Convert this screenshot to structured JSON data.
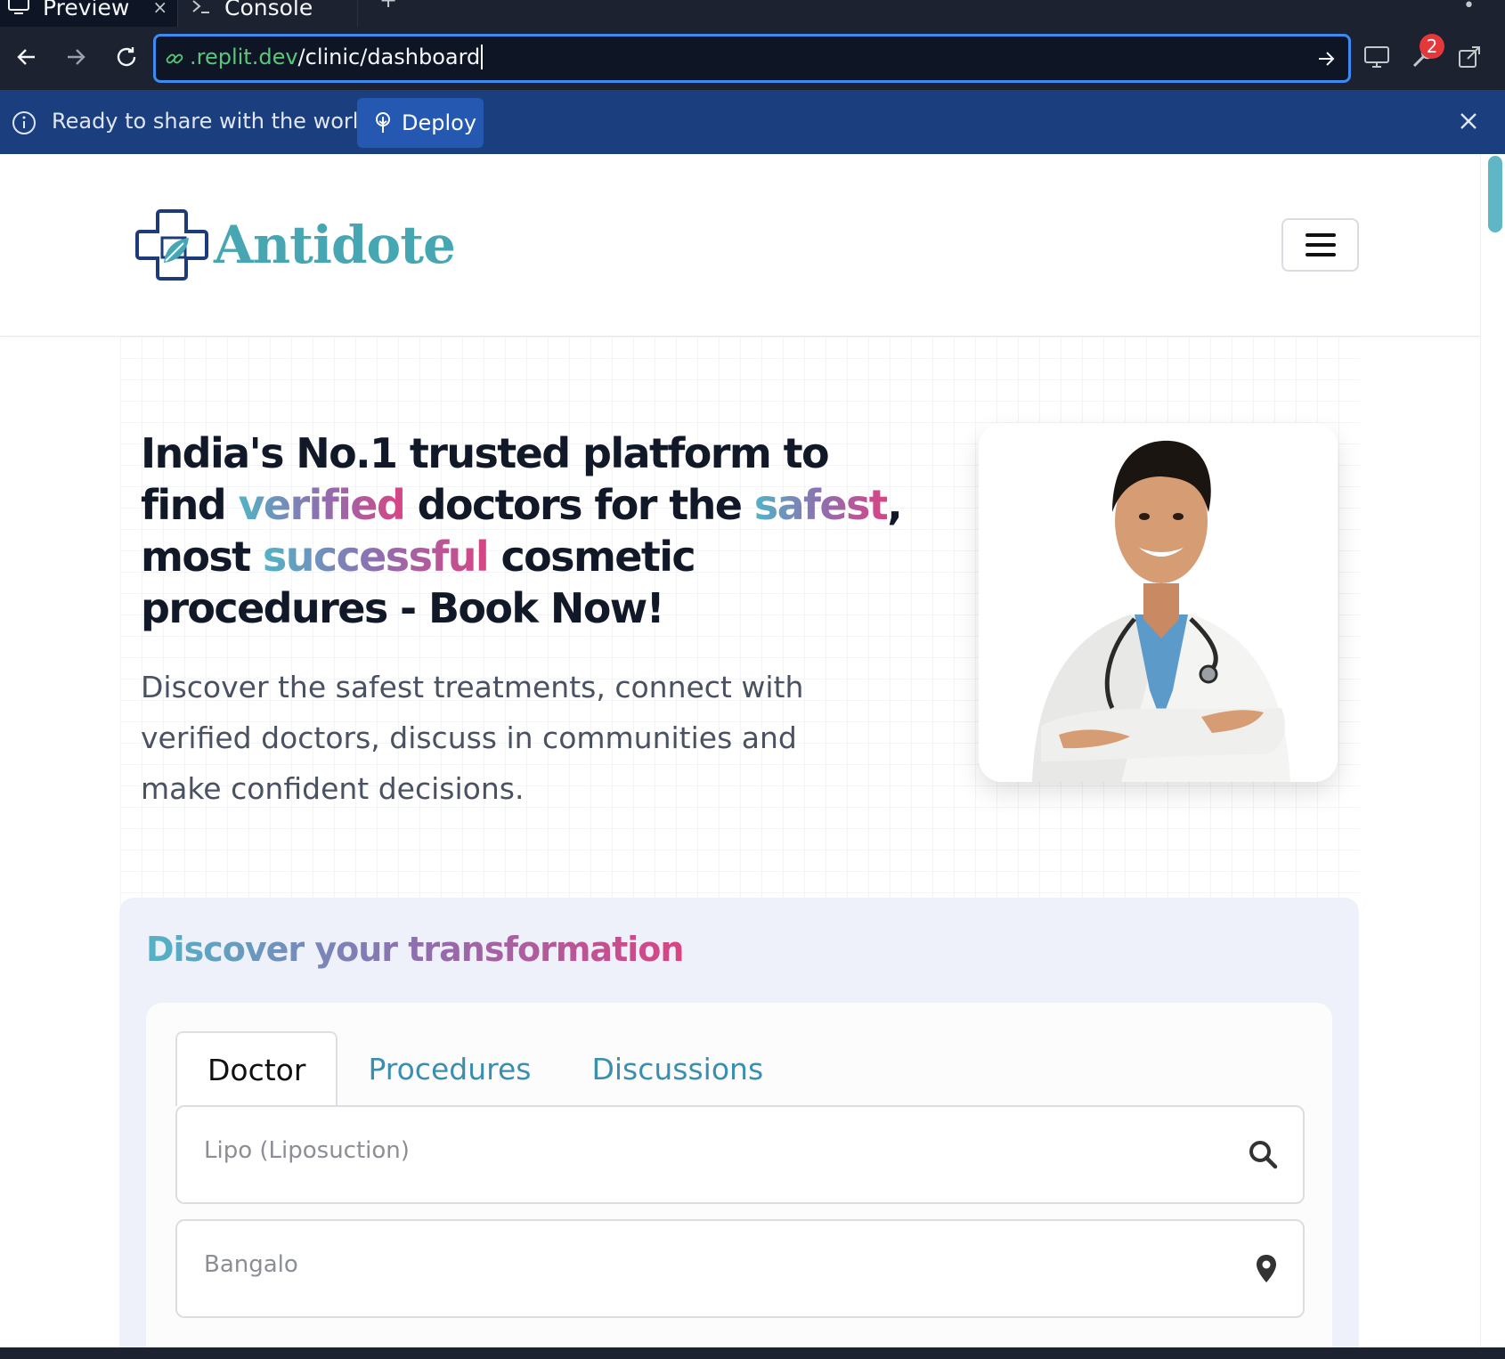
{
  "tabs": {
    "preview_label": "Preview",
    "console_label": "Console",
    "close_glyph": "×",
    "new_tab_glyph": "+",
    "more_glyph": "•"
  },
  "browser": {
    "url_host": ".replit.dev",
    "url_path": "/clinic/dashboard",
    "badge_count": "2"
  },
  "banner": {
    "message": "Ready to share with the world?",
    "deploy_label": "Deploy"
  },
  "site": {
    "brand": "Antidote",
    "brand_color": "#46a7b2"
  },
  "hero": {
    "title_1": "India's No.1 trusted platform to find ",
    "title_hl1": "verified",
    "title_2": " doctors for the ",
    "title_hl2": "safest",
    "title_3": ", most ",
    "title_hl3": "successful",
    "title_4": " cosmetic procedures - Book Now!",
    "subtitle": "Discover the safest treatments, connect with verified doctors, discuss in communities and make confident decisions."
  },
  "discover": {
    "title": "Discover your transformation",
    "tabs": [
      {
        "label": "Doctor",
        "active": true
      },
      {
        "label": "Procedures",
        "active": false
      },
      {
        "label": "Discussions",
        "active": false
      }
    ],
    "procedure_placeholder": "Lipo (Liposuction)",
    "location_placeholder": "Bangalo"
  },
  "icons": {
    "tab_preview": "monitor-icon",
    "tab_console": "terminal-icon",
    "back": "arrow-left-icon",
    "forward": "arrow-right-icon",
    "reload": "reload-icon",
    "url_link": "link-icon",
    "url_go": "arrow-right-icon",
    "devices": "monitor-icon",
    "devtools": "wrench-icon",
    "open_new": "external-link-icon",
    "info": "info-icon",
    "deploy": "deploy-icon",
    "close": "close-icon",
    "menu": "hamburger-icon",
    "search": "search-icon",
    "location": "map-pin-icon"
  }
}
